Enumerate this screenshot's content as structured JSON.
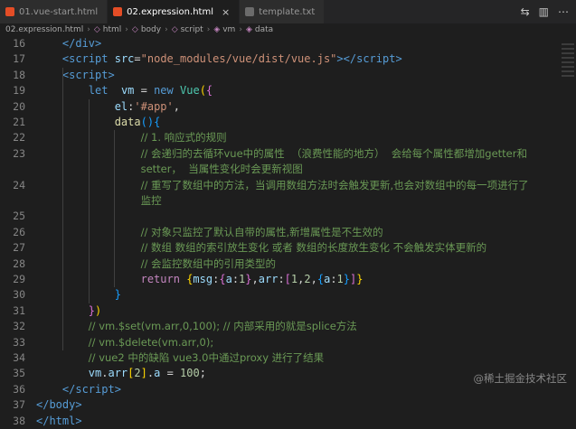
{
  "tabs": [
    {
      "label": "01.vue-start.html",
      "active": false,
      "icon_color": "#e44d26"
    },
    {
      "label": "02.expression.html",
      "active": true,
      "icon_color": "#e44d26"
    },
    {
      "label": "template.txt",
      "active": false,
      "icon_color": "#6b6b6b"
    }
  ],
  "tab_close_glyph": "×",
  "breadcrumb": [
    "02.expression.html",
    "html",
    "body",
    "script",
    "vm",
    "data"
  ],
  "watermark": "@稀土掘金技术社区",
  "lines": [
    {
      "n": "16",
      "tokens": [
        [
          "p",
          "    "
        ],
        [
          "tag",
          "</"
        ],
        [
          "tag",
          "div"
        ],
        [
          "tag",
          ">"
        ]
      ]
    },
    {
      "n": "17",
      "tokens": [
        [
          "p",
          "    "
        ],
        [
          "tag",
          "<"
        ],
        [
          "tag",
          "script"
        ],
        [
          "p",
          " "
        ],
        [
          "attr",
          "src"
        ],
        [
          "p",
          "="
        ],
        [
          "str",
          "\"node_modules/vue/dist/vue.js\""
        ],
        [
          "tag",
          ">"
        ],
        [
          "tag",
          "</"
        ],
        [
          "tag",
          "script"
        ],
        [
          "tag",
          ">"
        ]
      ]
    },
    {
      "n": "18",
      "tokens": [
        [
          "p",
          "    "
        ],
        [
          "tag",
          "<"
        ],
        [
          "tag",
          "script"
        ],
        [
          "tag",
          ">"
        ]
      ]
    },
    {
      "n": "19",
      "tokens": [
        [
          "p",
          "        "
        ],
        [
          "kw",
          "let"
        ],
        [
          "p",
          "  "
        ],
        [
          "var",
          "vm"
        ],
        [
          "p",
          " = "
        ],
        [
          "kw",
          "new"
        ],
        [
          "p",
          " "
        ],
        [
          "cls",
          "Vue"
        ],
        [
          "br1",
          "("
        ],
        [
          "br2",
          "{"
        ]
      ]
    },
    {
      "n": "20",
      "tokens": [
        [
          "p",
          "            "
        ],
        [
          "var",
          "el"
        ],
        [
          "p",
          ":"
        ],
        [
          "str",
          "'#app'"
        ],
        [
          "p",
          ","
        ]
      ]
    },
    {
      "n": "21",
      "tokens": [
        [
          "p",
          "            "
        ],
        [
          "fn",
          "data"
        ],
        [
          "br3",
          "()"
        ],
        [
          "br3",
          "{"
        ]
      ]
    },
    {
      "n": "22",
      "tokens": [
        [
          "p",
          "                "
        ],
        [
          "comment",
          "// 1. 响应式的规则"
        ]
      ]
    },
    {
      "n": "23",
      "tokens": [
        [
          "p",
          "                "
        ],
        [
          "comment",
          "// 会递归的去循环vue中的属性  （浪费性能的地方）  会给每个属性都增加getter和"
        ]
      ]
    },
    {
      "n": "",
      "tokens": [
        [
          "p",
          "                "
        ],
        [
          "comment",
          "setter，  当属性变化时会更新视图"
        ]
      ]
    },
    {
      "n": "24",
      "tokens": [
        [
          "p",
          "                "
        ],
        [
          "comment",
          "// 重写了数组中的方法，当调用数组方法时会触发更新,也会对数组中的每一项进行了"
        ]
      ]
    },
    {
      "n": "",
      "tokens": [
        [
          "p",
          "                "
        ],
        [
          "comment",
          "监控"
        ]
      ]
    },
    {
      "n": "25",
      "tokens": []
    },
    {
      "n": "26",
      "tokens": [
        [
          "p",
          "                "
        ],
        [
          "comment",
          "// 对象只监控了默认自带的属性,新增属性是不生效的"
        ]
      ]
    },
    {
      "n": "27",
      "tokens": [
        [
          "p",
          "                "
        ],
        [
          "comment",
          "// 数组 数组的索引放生变化 或者 数组的长度放生变化 不会触发实体更新的"
        ]
      ]
    },
    {
      "n": "28",
      "tokens": [
        [
          "p",
          "                "
        ],
        [
          "comment",
          "// 会监控数组中的引用类型的"
        ]
      ]
    },
    {
      "n": "29",
      "tokens": [
        [
          "p",
          "                "
        ],
        [
          "ctl",
          "return"
        ],
        [
          "p",
          " "
        ],
        [
          "br1",
          "{"
        ],
        [
          "var",
          "msg"
        ],
        [
          "p",
          ":"
        ],
        [
          "br2",
          "{"
        ],
        [
          "var",
          "a"
        ],
        [
          "p",
          ":"
        ],
        [
          "num",
          "1"
        ],
        [
          "br2",
          "}"
        ],
        [
          "p",
          ","
        ],
        [
          "var",
          "arr"
        ],
        [
          "p",
          ":"
        ],
        [
          "br2",
          "["
        ],
        [
          "num",
          "1"
        ],
        [
          "p",
          ","
        ],
        [
          "num",
          "2"
        ],
        [
          "p",
          ","
        ],
        [
          "br3",
          "{"
        ],
        [
          "var",
          "a"
        ],
        [
          "p",
          ":"
        ],
        [
          "num",
          "1"
        ],
        [
          "br3",
          "}"
        ],
        [
          "br2",
          "]"
        ],
        [
          "br1",
          "}"
        ]
      ]
    },
    {
      "n": "30",
      "tokens": [
        [
          "p",
          "            "
        ],
        [
          "br3",
          "}"
        ]
      ]
    },
    {
      "n": "31",
      "tokens": [
        [
          "p",
          "        "
        ],
        [
          "br2",
          "}"
        ],
        [
          "br1",
          ")"
        ]
      ]
    },
    {
      "n": "32",
      "tokens": [
        [
          "p",
          "        "
        ],
        [
          "comment",
          "// vm.$set(vm.arr,0,100); // 内部采用的就是splice方法"
        ]
      ]
    },
    {
      "n": "33",
      "tokens": [
        [
          "p",
          "        "
        ],
        [
          "comment",
          "// vm.$delete(vm.arr,0);"
        ]
      ]
    },
    {
      "n": "34",
      "tokens": [
        [
          "p",
          "        "
        ],
        [
          "comment",
          "// vue2 中的缺陷 vue3.0中通过proxy 进行了结果"
        ]
      ]
    },
    {
      "n": "35",
      "tokens": [
        [
          "p",
          "        "
        ],
        [
          "var",
          "vm"
        ],
        [
          "p",
          "."
        ],
        [
          "var",
          "arr"
        ],
        [
          "br1",
          "["
        ],
        [
          "num",
          "2"
        ],
        [
          "br1",
          "]"
        ],
        [
          "p",
          "."
        ],
        [
          "var",
          "a"
        ],
        [
          "p",
          " = "
        ],
        [
          "num",
          "100"
        ],
        [
          "p",
          ";"
        ]
      ]
    },
    {
      "n": "36",
      "tokens": [
        [
          "p",
          "    "
        ],
        [
          "tag",
          "</"
        ],
        [
          "tag",
          "script"
        ],
        [
          "tag",
          ">"
        ]
      ]
    },
    {
      "n": "37",
      "tokens": [
        [
          "tag",
          "</"
        ],
        [
          "tag",
          "body"
        ],
        [
          "tag",
          ">"
        ]
      ]
    },
    {
      "n": "38",
      "tokens": [
        [
          "tag",
          "</"
        ],
        [
          "tag",
          "html"
        ],
        [
          "tag",
          ">"
        ]
      ]
    }
  ]
}
